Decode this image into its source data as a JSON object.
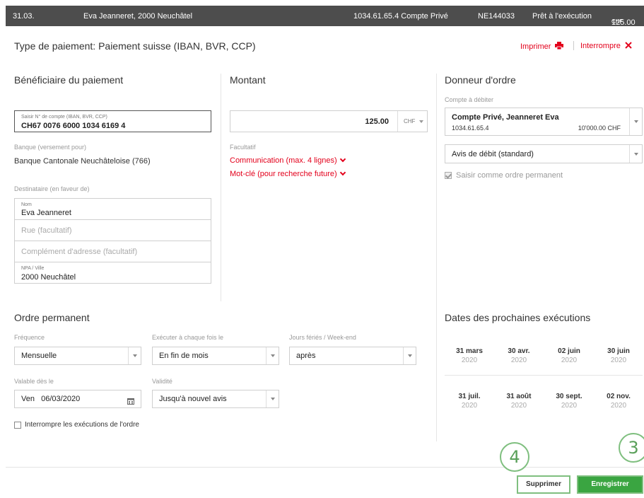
{
  "topbar": {
    "date": "31.03.",
    "beneficiary": "Eva Jeanneret, 2000 Neuchâtel",
    "account": "1034.61.65.4 Compte Privé",
    "reference": "NE144033",
    "status": "Prêt à l'exécution",
    "amount": "125.00",
    "currency": "CHF"
  },
  "header": {
    "title": "Type de paiement: Paiement suisse (IBAN, BVR, CCP)",
    "print_label": "Imprimer",
    "cancel_label": "Interrompre"
  },
  "beneficiary": {
    "title": "Bénéficiaire du paiement",
    "account_label": "Saisir N° de compte (IBAN, BVR, CCP)",
    "account_value": "CH67 0076 6000 1034 6169 4",
    "bank_label": "Banque (versement pour)",
    "bank_value": "Banque Cantonale Neuchâteloise (766)",
    "recipient_label": "Destinataire (en faveur de)",
    "name_label": "Nom",
    "name_value": "Eva Jeanneret",
    "street_placeholder": "Rue (facultatif)",
    "address_placeholder": "Complément d'adresse (facultatif)",
    "city_label": "NPA / Ville",
    "city_value": "2000 Neuchâtel"
  },
  "amount": {
    "title": "Montant",
    "value": "125.00",
    "currency": "CHF",
    "optional_label": "Facultatif",
    "communication_link": "Communication (max. 4 lignes)",
    "keyword_link": "Mot-clé (pour recherche future)"
  },
  "orderer": {
    "title": "Donneur d'ordre",
    "debit_label": "Compte à débiter",
    "account_name": "Compte Privé, Jeanneret Eva",
    "account_number": "1034.61.65.4",
    "balance": "10'000.00 CHF",
    "advice_value": "Avis de débit (standard)",
    "standing_order_label": "Saisir comme ordre permanent",
    "standing_order_checked": true
  },
  "standing_order": {
    "title": "Ordre permanent",
    "frequency_label": "Fréquence",
    "frequency_value": "Mensuelle",
    "execute_label": "Exécuter à chaque fois le",
    "execute_value": "En fin de mois",
    "holidays_label": "Jours fériés / Week-end",
    "holidays_value": "après",
    "valid_from_label": "Valable dès le",
    "valid_from_value": "Ven   06/03/2020",
    "validity_label": "Validité",
    "validity_value": "Jusqu'à nouvel avis",
    "interrupt_label": "Interrompre les exécutions de l'ordre"
  },
  "next_dates": {
    "title": "Dates des prochaines exécutions",
    "dates": [
      {
        "day": "31 mars",
        "year": "2020"
      },
      {
        "day": "30 avr.",
        "year": "2020"
      },
      {
        "day": "02 juin",
        "year": "2020"
      },
      {
        "day": "30 juin",
        "year": "2020"
      },
      {
        "day": "31 juil.",
        "year": "2020"
      },
      {
        "day": "31 août",
        "year": "2020"
      },
      {
        "day": "30 sept.",
        "year": "2020"
      },
      {
        "day": "02 nov.",
        "year": "2020"
      }
    ]
  },
  "actions": {
    "delete_label": "Supprimer",
    "save_label": "Enregistrer",
    "callout_delete": "4",
    "callout_save": "3"
  },
  "colors": {
    "accent": "#e3001b",
    "topbar": "#4d4d4d",
    "save": "#3aa541"
  }
}
